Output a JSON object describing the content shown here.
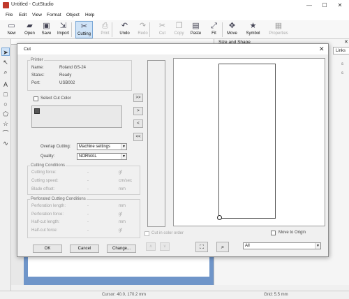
{
  "window": {
    "title": "Untitled - CutStudio",
    "min": "—",
    "max": "☐",
    "close": "✕"
  },
  "menu": [
    "File",
    "Edit",
    "View",
    "Format",
    "Object",
    "Help"
  ],
  "toolbar": [
    {
      "label": "New",
      "icon": "new-icon",
      "glyph": "▭",
      "state": "normal"
    },
    {
      "label": "Open",
      "icon": "open-icon",
      "glyph": "▰",
      "state": "normal"
    },
    {
      "label": "Save",
      "icon": "save-icon",
      "glyph": "▣",
      "state": "normal"
    },
    {
      "label": "Import",
      "icon": "import-icon",
      "glyph": "⇲",
      "state": "normal"
    },
    {
      "label": "Cutting",
      "icon": "cutting-icon",
      "glyph": "✂",
      "state": "active"
    },
    {
      "label": "Print",
      "icon": "print-icon",
      "glyph": "⎙",
      "state": "disabled"
    },
    {
      "label": "Undo",
      "icon": "undo-icon",
      "glyph": "↶",
      "state": "normal"
    },
    {
      "label": "Redo",
      "icon": "redo-icon",
      "glyph": "↷",
      "state": "disabled"
    },
    {
      "label": "Cut",
      "icon": "cut-icon",
      "glyph": "✂",
      "state": "disabled"
    },
    {
      "label": "Copy",
      "icon": "copy-icon",
      "glyph": "❐",
      "state": "disabled"
    },
    {
      "label": "Paste",
      "icon": "paste-icon",
      "glyph": "▤",
      "state": "normal"
    },
    {
      "label": "Fit",
      "icon": "fit-icon",
      "glyph": "⤢",
      "state": "normal"
    },
    {
      "label": "Move",
      "icon": "move-icon",
      "glyph": "✥",
      "state": "normal"
    },
    {
      "label": "Symbol",
      "icon": "symbol-icon",
      "glyph": "★",
      "state": "normal"
    },
    {
      "label": "Properties",
      "icon": "properties-icon",
      "glyph": "▦",
      "state": "disabled"
    }
  ],
  "panel": {
    "title": "Size and Shape",
    "close": "✕",
    "tab": "Links",
    "items": [
      "s",
      "s"
    ]
  },
  "status": {
    "cursor": "Cursor: 40.0, 170.2 mm",
    "grid": "Grid: 5.5 mm"
  },
  "dialog": {
    "title": "Cut",
    "close": "✕",
    "printer": {
      "legend": "Printer",
      "name_label": "Name:",
      "name": "Roland GS-24",
      "status_label": "Status:",
      "status": "Ready",
      "port_label": "Port:",
      "port": "USB002"
    },
    "select_cut_color": "Select Cut Color",
    "cut_color": "#555555",
    "transfer_buttons": [
      ">>",
      ">",
      "<",
      "<<"
    ],
    "overlap_label": "Overlap Cutting:",
    "overlap_value": "Machine settings",
    "quality_label": "Quality:",
    "quality_value": "NORMAL",
    "conditions": {
      "legend": "Cutting Conditions",
      "rows": [
        {
          "label": "Cutting force:",
          "value": "-",
          "unit": "gf"
        },
        {
          "label": "Cutting speed:",
          "value": "-",
          "unit": "cm/sec"
        },
        {
          "label": "Blade offset:",
          "value": "-",
          "unit": "mm"
        }
      ]
    },
    "perforated": {
      "legend": "Perforated Cutting Conditions",
      "rows": [
        {
          "label": "Perforation length:",
          "value": "-",
          "unit": "mm"
        },
        {
          "label": "Perforation force:",
          "value": "-",
          "unit": "gf"
        },
        {
          "label": "Half-cut length:",
          "value": "-",
          "unit": "mm"
        },
        {
          "label": "Half-cut force:",
          "value": "-",
          "unit": "gf"
        }
      ]
    },
    "cut_in_color_order": "Cut in color order",
    "move_to_origin": "Move to Origin",
    "view_select": "All",
    "ok": "OK",
    "cancel": "Cancel",
    "change": "Change..."
  }
}
